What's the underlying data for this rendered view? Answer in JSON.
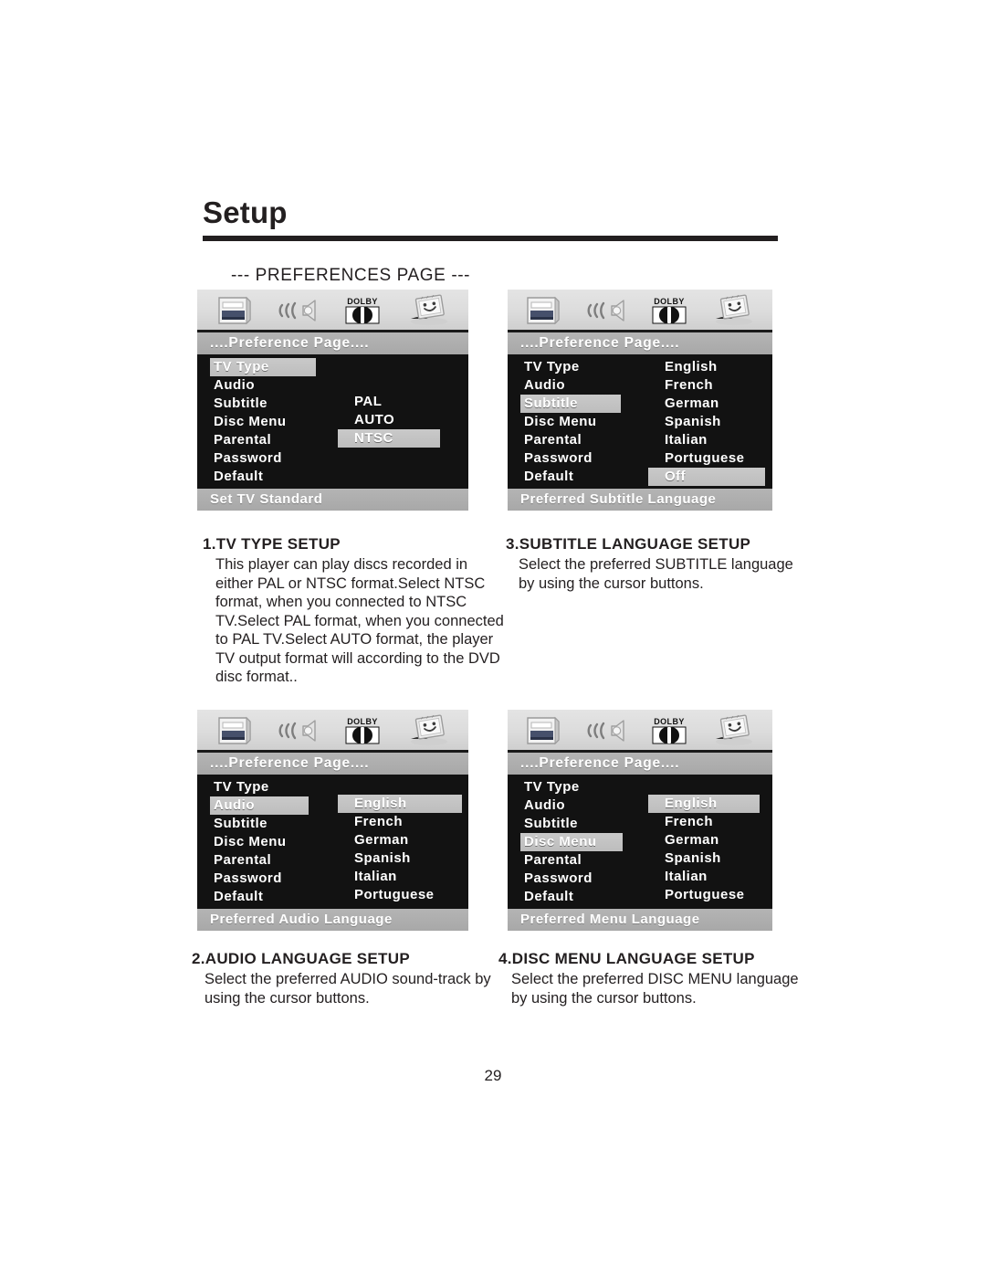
{
  "document": {
    "chapter_title": "Setup",
    "section_caption": "--- PREFERENCES PAGE ---",
    "page_number": "29"
  },
  "icons": {
    "general_setup": "tv-card-icon",
    "audio_setup": "speaker-waves-icon",
    "dolby": "dolby-digital-icon",
    "preference": "display-face-icon",
    "dolby_wordmark": "DOLBY"
  },
  "menus": [
    {
      "id": "tv-type",
      "title": "....Preference Page....",
      "status": "Set TV Standard",
      "left_items": [
        {
          "label": "TV Type",
          "selected": true
        },
        {
          "label": "Audio",
          "selected": false
        },
        {
          "label": "Subtitle",
          "selected": false
        },
        {
          "label": "Disc Menu",
          "selected": false
        },
        {
          "label": "Parental",
          "selected": false
        },
        {
          "label": "Password",
          "selected": false
        },
        {
          "label": "Default",
          "selected": false
        }
      ],
      "right_items": [
        {
          "label": "PAL",
          "selected": false
        },
        {
          "label": "AUTO",
          "selected": false
        },
        {
          "label": "NTSC",
          "selected": true
        }
      ]
    },
    {
      "id": "subtitle",
      "title": "....Preference Page....",
      "status": "Preferred Subtitle Language",
      "left_items": [
        {
          "label": "TV Type",
          "selected": false
        },
        {
          "label": "Audio",
          "selected": false
        },
        {
          "label": "Subtitle",
          "selected": true
        },
        {
          "label": "Disc Menu",
          "selected": false
        },
        {
          "label": "Parental",
          "selected": false
        },
        {
          "label": "Password",
          "selected": false
        },
        {
          "label": "Default",
          "selected": false
        }
      ],
      "right_items": [
        {
          "label": "English",
          "selected": false
        },
        {
          "label": "French",
          "selected": false
        },
        {
          "label": "German",
          "selected": false
        },
        {
          "label": "Spanish",
          "selected": false
        },
        {
          "label": "Italian",
          "selected": false
        },
        {
          "label": "Portuguese",
          "selected": false
        },
        {
          "label": "Off",
          "selected": true
        }
      ]
    },
    {
      "id": "audio",
      "title": "....Preference Page....",
      "status": "Preferred Audio Language",
      "left_items": [
        {
          "label": "TV Type",
          "selected": false
        },
        {
          "label": "Audio",
          "selected": true
        },
        {
          "label": "Subtitle",
          "selected": false
        },
        {
          "label": "Disc Menu",
          "selected": false
        },
        {
          "label": "Parental",
          "selected": false
        },
        {
          "label": "Password",
          "selected": false
        },
        {
          "label": "Default",
          "selected": false
        }
      ],
      "right_items": [
        {
          "label": "English",
          "selected": true
        },
        {
          "label": "French",
          "selected": false
        },
        {
          "label": "German",
          "selected": false
        },
        {
          "label": "Spanish",
          "selected": false
        },
        {
          "label": "Italian",
          "selected": false
        },
        {
          "label": "Portuguese",
          "selected": false
        }
      ]
    },
    {
      "id": "disc-menu",
      "title": "....Preference Page....",
      "status": "Preferred Menu Language",
      "left_items": [
        {
          "label": "TV Type",
          "selected": false
        },
        {
          "label": "Audio",
          "selected": false
        },
        {
          "label": "Subtitle",
          "selected": false
        },
        {
          "label": "Disc Menu",
          "selected": true
        },
        {
          "label": "Parental",
          "selected": false
        },
        {
          "label": "Password",
          "selected": false
        },
        {
          "label": "Default",
          "selected": false
        }
      ],
      "right_items": [
        {
          "label": "English",
          "selected": true
        },
        {
          "label": "French",
          "selected": false
        },
        {
          "label": "German",
          "selected": false
        },
        {
          "label": "Spanish",
          "selected": false
        },
        {
          "label": "Italian",
          "selected": false
        },
        {
          "label": "Portuguese",
          "selected": false
        }
      ]
    }
  ],
  "descriptions": [
    {
      "id": "tv-type-setup",
      "title": "1.TV TYPE SETUP",
      "body": "This player can play discs recorded in either PAL or NTSC format.Select NTSC format, when you connected to NTSC TV.Select PAL format, when you connected to PAL TV.Select AUTO format, the player TV output format will according to the DVD disc format.."
    },
    {
      "id": "audio-language-setup",
      "title": "2.AUDIO LANGUAGE SETUP",
      "body": "Select the preferred AUDIO sound-track by using the cursor buttons."
    },
    {
      "id": "subtitle-language-setup",
      "title": "3.SUBTITLE LANGUAGE SETUP",
      "body": "Select the preferred SUBTITLE language by using the cursor buttons."
    },
    {
      "id": "disc-menu-language-setup",
      "title": "4.DISC MENU LANGUAGE SETUP",
      "body": "Select the preferred DISC MENU language by using the cursor buttons."
    }
  ],
  "colors": {
    "ink": "#231f20",
    "osd_background": "#121212",
    "osd_bar": "#a8a8a8",
    "osd_highlight": "#c9c9c9",
    "osd_text": "#ffffff",
    "icon_strip": "#dcdcdc"
  }
}
